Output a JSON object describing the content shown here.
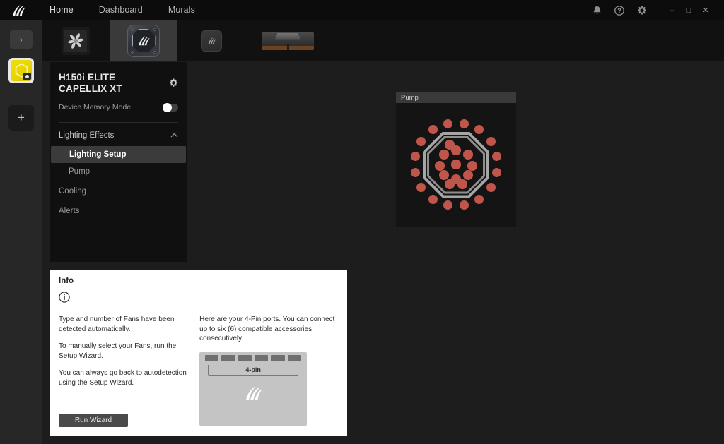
{
  "titlebar": {
    "logo_icon": "corsair-sails-logo",
    "nav": [
      {
        "label": "Home",
        "active": true
      },
      {
        "label": "Dashboard",
        "active": false
      },
      {
        "label": "Murals",
        "active": false
      }
    ],
    "icons": [
      {
        "name": "notifications-bell-icon",
        "glyph": "bell"
      },
      {
        "name": "help-icon",
        "glyph": "question"
      },
      {
        "name": "settings-gear-icon",
        "glyph": "gear"
      }
    ],
    "window_controls": [
      {
        "name": "minimize-button",
        "glyph": "–"
      },
      {
        "name": "maximize-button",
        "glyph": "□"
      },
      {
        "name": "close-button",
        "glyph": "✕"
      }
    ]
  },
  "rail": {
    "expand_icon": "chevron-right-icon",
    "expand_glyph": "›",
    "profile": {
      "name": "profile-tile-active",
      "icon": "hexagon-icon",
      "color": "#e8d400",
      "badge_icon": "lighting-badge-icon"
    },
    "add": {
      "name": "add-profile-button",
      "glyph": "+"
    }
  },
  "device_tabs": [
    {
      "name": "device-tab-fan",
      "icon": "fan-icon",
      "active": false
    },
    {
      "name": "device-tab-cooler",
      "icon": "pump-block-icon",
      "active": true
    },
    {
      "name": "device-tab-keyboard",
      "icon": "keycap-icon",
      "active": false
    },
    {
      "name": "device-tab-memory",
      "icon": "ram-module-icon",
      "active": false
    }
  ],
  "device_panel": {
    "title": "H150i ELITE CAPELLIX XT",
    "gear_icon": "gear-icon",
    "memory_mode": {
      "label": "Device Memory Mode",
      "enabled": false
    },
    "section": {
      "label": "Lighting Effects",
      "expanded": true,
      "chevron_icon": "chevron-up-icon"
    },
    "items": [
      {
        "label": "Lighting Setup",
        "active": true,
        "indent": "sub"
      },
      {
        "label": "Pump",
        "active": false,
        "indent": "sub"
      },
      {
        "label": "Cooling",
        "active": false,
        "indent": "root"
      },
      {
        "label": "Alerts",
        "active": false,
        "indent": "root"
      }
    ]
  },
  "pump_preview": {
    "header": "Pump",
    "led_color": "#c0564b",
    "outer_ring_count": 16,
    "inner_cluster_count": 12,
    "ring_shape": "octagon"
  },
  "info_panel": {
    "title": "Info",
    "info_icon": "info-circle-icon",
    "left_paragraphs": [
      "Type and number of Fans have been detected automatically.",
      "To manually select your Fans, run the Setup Wizard.",
      "You can always go back to autodetection using the Setup Wizard."
    ],
    "right_paragraphs": [
      "Here are your 4-Pin ports. You can connect up to six (6) compatible accessories consecutively."
    ],
    "port_diagram": {
      "label": "4-pin",
      "port_count": 6,
      "logo_icon": "corsair-sails-logo"
    },
    "run_wizard_button": "Run Wizard"
  }
}
